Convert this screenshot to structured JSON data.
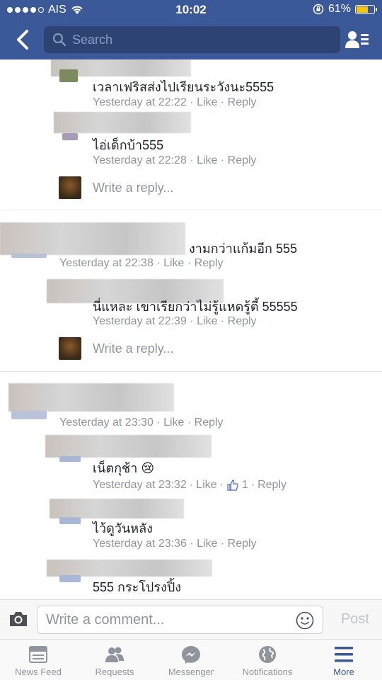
{
  "status_bar": {
    "carrier": "AIS",
    "time": "10:02",
    "battery": "61%",
    "battery_level": 0.61
  },
  "navbar": {
    "search_placeholder": "Search"
  },
  "comments": [
    {
      "text": "เวลาเฟริสส่งไปเรียนระวังนะ5555",
      "time": "Yesterday at 22:22",
      "like": "Like",
      "reply": "Reply"
    },
    {
      "text": "ไอ่เด็กบ้า555",
      "time": "Yesterday at 22:28",
      "like": "Like",
      "reply": "Reply"
    },
    {
      "text": "งามกว่าแก้มอีก 555",
      "time": "Yesterday at 22:38",
      "like": "Like",
      "reply": "Reply"
    },
    {
      "text": "นี่แหละ เขาเรียกว่าไม่รู้แหดรู้ตี้ 55555",
      "time": "Yesterday at 22:39",
      "like": "Like",
      "reply": "Reply"
    },
    {
      "time": "Yesterday at 23:30",
      "like": "Like",
      "reply": "Reply"
    },
    {
      "text": "เน็ตกุช้า 😢",
      "time": "Yesterday at 23:32",
      "like": "Like",
      "like_count": "1",
      "reply": "Reply"
    },
    {
      "text": "ไว้ดูวันหลัง",
      "time": "Yesterday at 23:36",
      "like": "Like",
      "reply": "Reply"
    },
    {
      "text": "555 กระโปรงปิ้ง"
    }
  ],
  "reply_placeholder": "Write a reply...",
  "composer": {
    "placeholder": "Write a comment...",
    "post_label": "Post"
  },
  "tabs": [
    {
      "label": "News Feed",
      "icon": "news-feed-icon"
    },
    {
      "label": "Requests",
      "icon": "requests-icon"
    },
    {
      "label": "Messenger",
      "icon": "messenger-icon"
    },
    {
      "label": "Notifications",
      "icon": "globe-icon"
    },
    {
      "label": "More",
      "icon": "menu-icon"
    }
  ],
  "colors": {
    "brand": "#3b5998",
    "meta_text": "#90949c"
  }
}
